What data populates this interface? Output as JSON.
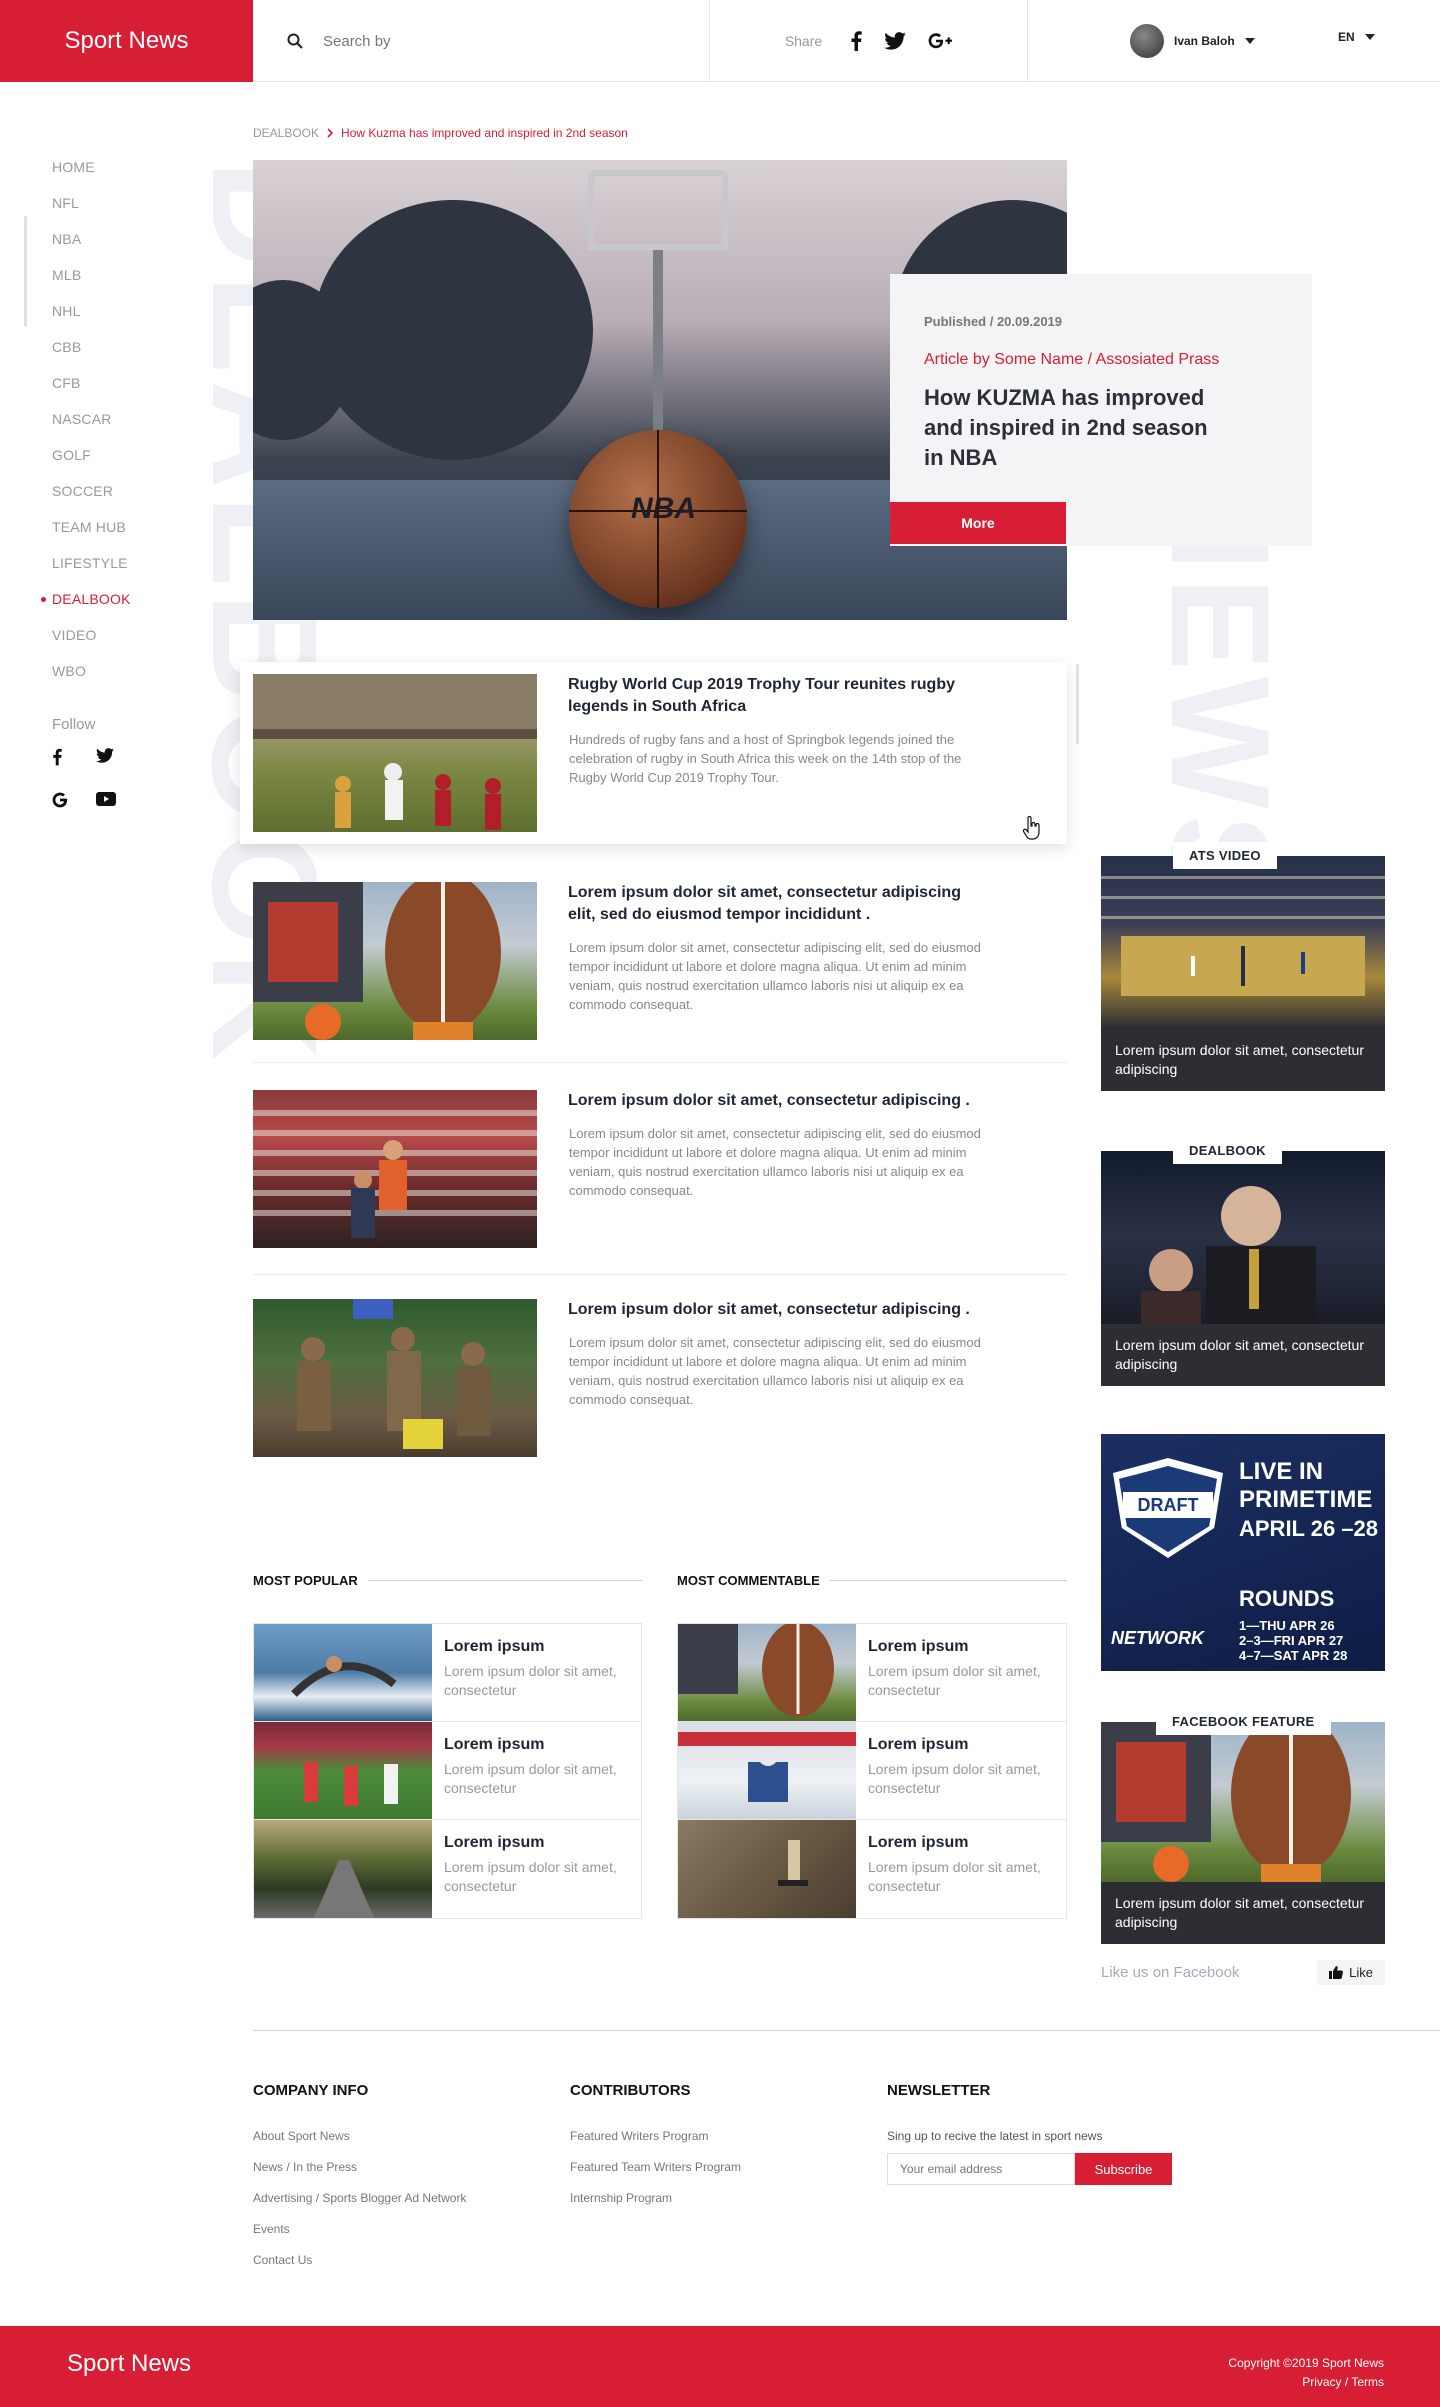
{
  "brand": "Sport News",
  "search": {
    "placeholder": "Search by"
  },
  "share": {
    "label": "Share"
  },
  "user": {
    "name": "Ivan Baloh"
  },
  "lang": "EN",
  "nav": {
    "items": [
      "HOME",
      "NFL",
      "NBA",
      "MLB",
      "NHL",
      "CBB",
      "CFB",
      "NASCAR",
      "GOLF",
      "SOCCER",
      "TEAM HUB",
      "LIFESTYLE",
      "DEALBOOK",
      "VIDEO",
      "WBO"
    ],
    "active": "DEALBOOK",
    "follow": "Follow"
  },
  "watermarks": {
    "left": "DEALBOOK",
    "right": "NEWS"
  },
  "breadcrumb": {
    "parent": "DEALBOOK",
    "current": "How Kuzma has improved and inspired in 2nd season"
  },
  "hero": {
    "published": "Published / 20.09.2019",
    "author": "Article by Some Name / Assosiated Prass",
    "title": "How KUZMA has improved and inspired in 2nd season in NBA",
    "more": "More",
    "ball_text": "NBA"
  },
  "articles": [
    {
      "title": "Rugby World Cup 2019 Trophy Tour reunites rugby legends in South Africa",
      "text": "Hundreds of rugby fans and a host of Springbok legends joined the celebration of rugby in South Africa this week on the 14th stop of the Rugby World Cup 2019 Trophy Tour."
    },
    {
      "title": "Lorem ipsum dolor sit amet, consectetur adipiscing elit, sed do eiusmod tempor incididunt .",
      "text": "Lorem ipsum dolor sit amet, consectetur adipiscing elit, sed do eiusmod tempor incididunt ut labore et dolore magna aliqua. Ut enim ad minim veniam, quis nostrud exercitation ullamco laboris nisi ut aliquip ex ea commodo consequat."
    },
    {
      "title": "Lorem ipsum dolor sit amet, consectetur adipiscing .",
      "text": "Lorem ipsum dolor sit amet, consectetur adipiscing elit, sed do eiusmod tempor incididunt ut labore et dolore magna aliqua. Ut enim ad minim veniam, quis nostrud exercitation ullamco laboris nisi ut aliquip ex ea commodo consequat."
    },
    {
      "title": "Lorem ipsum dolor sit amet, consectetur adipiscing .",
      "text": "Lorem ipsum dolor sit amet, consectetur adipiscing elit, sed do eiusmod tempor incididunt ut labore et dolore magna aliqua. Ut enim ad minim veniam, quis nostrud exercitation ullamco laboris nisi ut aliquip ex ea commodo consequat."
    }
  ],
  "right": {
    "ats_video": {
      "tag": "ATS VIDEO",
      "caption": "Lorem ipsum dolor sit amet, consectetur adipiscing"
    },
    "dealbook": {
      "tag": "DEALBOOK",
      "caption": "Lorem ipsum dolor sit amet, consectetur adipiscing"
    },
    "ad": {
      "title": "LIVE IN PRIMETIME",
      "dates": "APRIL 26 –28",
      "rounds": "ROUNDS",
      "schedule": "1—THU APR 26\n2–3—FRI APR 27\n4–7—SAT APR 28",
      "badge": "DRAFT",
      "network": "NETWORK"
    },
    "facebook": {
      "tag": "FACEBOOK FEATURE",
      "caption": "Lorem ipsum dolor sit amet, consectetur adipiscing",
      "like_text": "Like us on Facebook",
      "like_button": "Like"
    }
  },
  "most_popular": {
    "title": "MOST POPULAR",
    "items": [
      {
        "title": "Lorem ipsum",
        "text": "Lorem ipsum dolor sit amet, consectetur"
      },
      {
        "title": "Lorem ipsum",
        "text": "Lorem ipsum dolor sit amet, consectetur"
      },
      {
        "title": "Lorem ipsum",
        "text": "Lorem ipsum dolor sit amet, consectetur"
      }
    ]
  },
  "most_commentable": {
    "title": "MOST COMMENTABLE",
    "items": [
      {
        "title": "Lorem ipsum",
        "text": "Lorem ipsum dolor sit amet, consectetur"
      },
      {
        "title": "Lorem ipsum",
        "text": "Lorem ipsum dolor sit amet, consectetur"
      },
      {
        "title": "Lorem ipsum",
        "text": "Lorem ipsum dolor sit amet, consectetur"
      }
    ]
  },
  "footer": {
    "company": {
      "title": "COMPANY INFO",
      "links": [
        "About Sport News",
        "News / In the Press",
        "Advertising / Sports Blogger Ad Network",
        "Events",
        "Contact Us"
      ]
    },
    "contributors": {
      "title": "CONTRIBUTORS",
      "links": [
        "Featured Writers Program",
        "Featured Team Writers Program",
        "Internship Program"
      ]
    },
    "newsletter": {
      "title": "NEWSLETTER",
      "text": "Sing up to recive the latest in sport news",
      "placeholder": "Your email address",
      "button": "Subscribe"
    },
    "brand": "Sport News",
    "copyright": "Copyright ©2019 Sport News",
    "legal": "Privacy / Terms"
  },
  "colors": {
    "accent": "#d81e34",
    "dark_caption": "#2d2e33",
    "watermark": "#eef0f5"
  }
}
